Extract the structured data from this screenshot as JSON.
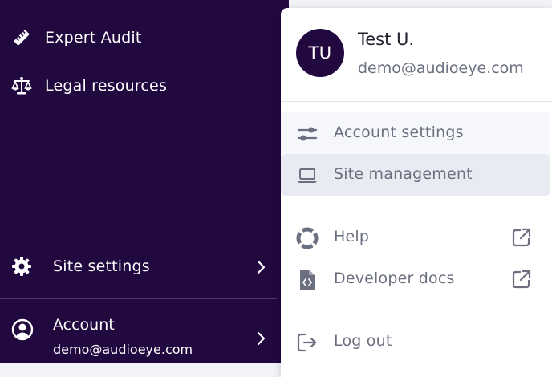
{
  "sidebar": {
    "items": [
      {
        "label": "Expert Audit",
        "icon": "ruler-icon"
      },
      {
        "label": "Legal resources",
        "icon": "scale-icon"
      },
      {
        "label": "Site settings",
        "icon": "gear-icon"
      }
    ],
    "account": {
      "title": "Account",
      "email": "demo@audioeye.com",
      "icon": "user-circle-icon"
    }
  },
  "user_menu": {
    "avatar_initials": "TU",
    "name": "Test U.",
    "email": "demo@audioeye.com",
    "items": [
      {
        "label": "Account settings",
        "icon": "sliders-icon"
      },
      {
        "label": "Site management",
        "icon": "laptop-icon"
      },
      {
        "label": "Help",
        "icon": "lifebuoy-icon",
        "external": true
      },
      {
        "label": "Developer docs",
        "icon": "code-file-icon",
        "external": true
      },
      {
        "label": "Log out",
        "icon": "logout-icon"
      }
    ]
  },
  "colors": {
    "sidebar_bg": "#21083f",
    "menu_text": "#6b6f80",
    "highlight_bg": "#e9ebf3"
  }
}
